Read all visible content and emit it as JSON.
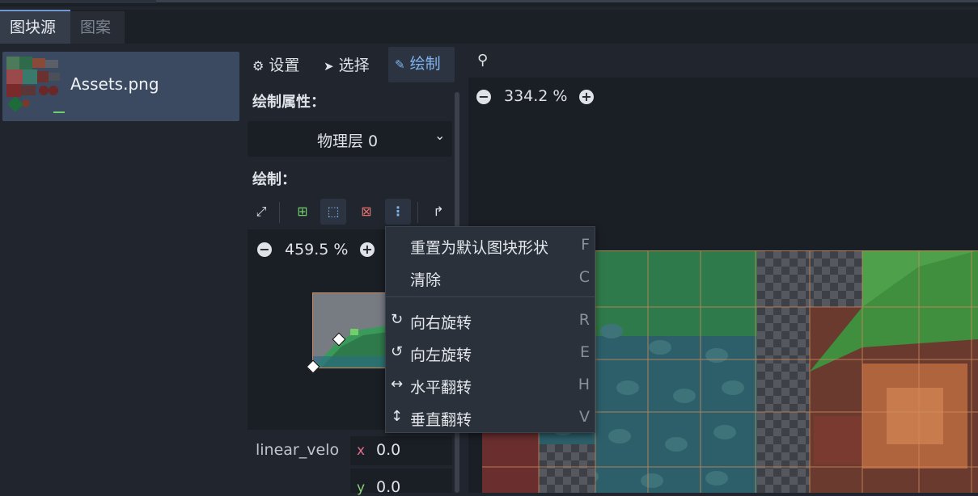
{
  "tabs": {
    "sources": "图块源",
    "patterns": "图案"
  },
  "source_list": {
    "item_name": "Assets.png"
  },
  "modes": {
    "settings": "设置",
    "select": "选择",
    "paint": "绘制"
  },
  "paint_props": {
    "label": "绘制属性：",
    "layer_value": "物理层 0",
    "paint_label": "绘制："
  },
  "editor_zoom": "459.5 %",
  "canvas_zoom": "334.2 %",
  "property": {
    "name": "linear_velo",
    "x_label": "x",
    "x_value": "0.0",
    "y_label": "y",
    "y_value": "0.0"
  },
  "menu": [
    {
      "label": "重置为默认图块形状",
      "shortcut": "F",
      "icon": ""
    },
    {
      "label": "清除",
      "shortcut": "C",
      "icon": ""
    },
    {
      "label": "向右旋转",
      "shortcut": "R",
      "icon": "rotate-right-icon"
    },
    {
      "label": "向左旋转",
      "shortcut": "E",
      "icon": "rotate-left-icon"
    },
    {
      "label": "水平翻转",
      "shortcut": "H",
      "icon": "flip-horizontal-icon"
    },
    {
      "label": "垂直翻转",
      "shortcut": "V",
      "icon": "flip-vertical-icon"
    }
  ],
  "colors": {
    "accent": "#7fb4f0",
    "selection": "#3b4a60",
    "tile_border": "#d08a5c"
  }
}
